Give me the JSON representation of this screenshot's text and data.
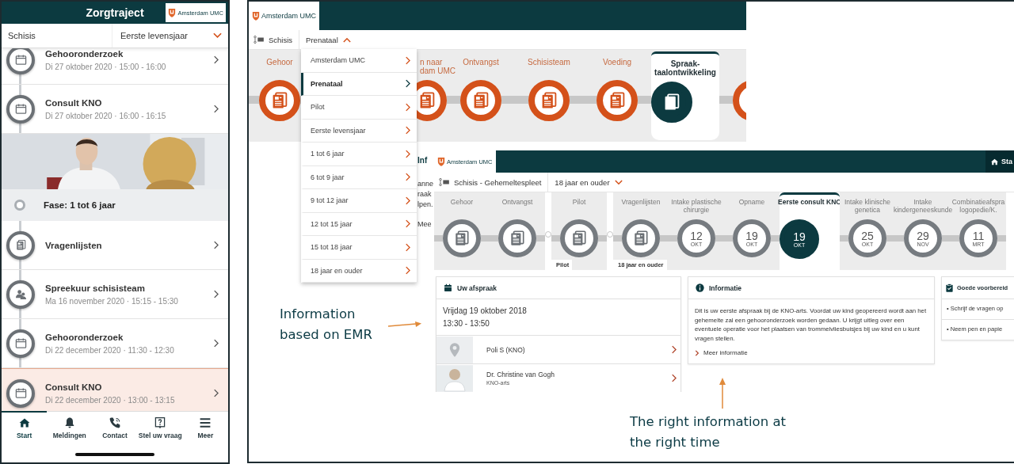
{
  "phone": {
    "title": "Zorgtraject",
    "logo": "Amsterdam UMC",
    "track": "Schisis",
    "phase": "Eerste levensjaar",
    "items": [
      {
        "kind": "appointment",
        "title": "Gehooronderzoek",
        "subtitle": "Di 27 oktober 2020 · 15:00 - 16:00",
        "selected": false
      },
      {
        "kind": "appointment",
        "title": "Consult KNO",
        "subtitle": "Di 27 oktober 2020 · 16:00 - 16:15",
        "selected": false
      },
      {
        "kind": "picture"
      },
      {
        "kind": "phase",
        "title": "Fase: 1 tot 6 jaar"
      },
      {
        "kind": "questionnaire",
        "title": "Vragenlijsten",
        "selected": false
      },
      {
        "kind": "team",
        "title": "Spreekuur schisisteam",
        "subtitle": "Ma 16 november 2020 · 15:15 - 15:30",
        "selected": false
      },
      {
        "kind": "appointment",
        "title": "Gehooronderzoek",
        "subtitle": "Di 22 december 2020 · 11:30 - 12:30",
        "selected": false
      },
      {
        "kind": "appointment",
        "title": "Consult KNO",
        "subtitle": "Di 22 december 2020 · 13:00 - 13:15",
        "selected": true
      }
    ],
    "tabs": [
      {
        "kind": "home",
        "label": "Start",
        "selected": true
      },
      {
        "kind": "bell",
        "label": "Meldingen",
        "selected": false
      },
      {
        "kind": "phone",
        "label": "Contact",
        "selected": false
      },
      {
        "kind": "question",
        "label": "Stel uw vraag",
        "selected": false
      },
      {
        "kind": "menu",
        "label": "Meer",
        "selected": false
      }
    ]
  },
  "web_top": {
    "logo": "Amsterdam UMC",
    "track": "Schisis",
    "phase": "Prenataal",
    "menu_open": true,
    "stages": [
      {
        "label": "Gehoor",
        "selected": false
      },
      {
        "label": "n naar\ndam UMC",
        "selected": false
      },
      {
        "label": "Ontvangst",
        "selected": false
      },
      {
        "label": "Schisisteam",
        "selected": false
      },
      {
        "label": "Voeding",
        "selected": false
      },
      {
        "label": "Spraak-\ntaalontwikkeling",
        "selected": true
      },
      {
        "selected": false
      }
    ],
    "menu": [
      {
        "label": "Amsterdam UMC",
        "selected": false
      },
      {
        "label": "Prenataal",
        "selected": true
      },
      {
        "label": "Pilot",
        "selected": false
      },
      {
        "label": "Eerste levensjaar",
        "selected": false
      },
      {
        "label": "1 tot 6 jaar",
        "selected": false
      },
      {
        "label": "6 tot 9 jaar",
        "selected": false
      },
      {
        "label": "9 tot 12 jaar",
        "selected": false
      },
      {
        "label": "12 tot 15 jaar",
        "selected": false
      },
      {
        "label": "15 tot 18 jaar",
        "selected": false
      },
      {
        "label": "18 jaar en ouder",
        "selected": false
      }
    ]
  },
  "web_behind": {
    "texts": [
      {
        "kind": "heading",
        "text": "Inf"
      },
      {
        "kind": "line",
        "text": "anne"
      },
      {
        "kind": "line",
        "text": "raak"
      },
      {
        "kind": "line",
        "text": "lpen."
      },
      {
        "kind": "link",
        "text": "Mee"
      }
    ]
  },
  "web_front": {
    "logo": "Amsterdam UMC",
    "home": "Sta",
    "track": "Schisis - Gehemeltespleet",
    "phase": "18 jaar en ouder",
    "groups": [
      {
        "stages": [
          {
            "label": "Gehoor",
            "kind": "document",
            "selected": false
          },
          {
            "label": "Ontvangst",
            "kind": "document",
            "selected": false
          }
        ]
      },
      {
        "label": "Pilot",
        "stages": [
          {
            "label": "Pilot",
            "kind": "document",
            "selected": false
          }
        ]
      },
      {
        "label": "18 jaar en ouder",
        "stages": [
          {
            "label": "Vragenlijsten",
            "kind": "document",
            "selected": false
          },
          {
            "label": "Intake plastische chirurgie",
            "kind": "date",
            "day": "12",
            "month": "OKT",
            "selected": false
          },
          {
            "label": "Opname",
            "kind": "date",
            "day": "19",
            "month": "OKT",
            "selected": false
          }
        ]
      },
      {
        "stages": [
          {
            "label": "Eerste consult KNO",
            "kind": "date",
            "day": "19",
            "month": "OKT",
            "selected": true
          }
        ]
      },
      {
        "stages": [
          {
            "label": "Intake klinische genetica",
            "kind": "date",
            "day": "25",
            "month": "OKT",
            "selected": false
          },
          {
            "label": "Intake kindergeneeskunde",
            "kind": "date",
            "day": "29",
            "month": "NOV",
            "selected": false
          },
          {
            "label": "Combinatieafspra\nlogopedie/K.",
            "kind": "date",
            "day": "11",
            "month": "MRT",
            "selected": false
          }
        ]
      }
    ],
    "appointment": {
      "title": "Uw afspraak",
      "date": "Vrijdag 19 oktober 2018",
      "time": "13:30 - 13:50",
      "location": "Poli S (KNO)",
      "doctor": "Dr. Christine van Gogh",
      "role": "KNO-arts"
    },
    "info": {
      "title": "Informatie",
      "text": "Dit is uw eerste afspraak bij de KNO-arts. Voordat uw kind geopereerd wordt aan het gehemelte zal een gehooronderzoek worden gedaan. U krijgt uitleg over een eventuele operatie voor het plaatsen van trommelvliesbuisjes bij uw kind en u kunt vragen stellen.",
      "link": "Meer informatie"
    },
    "prep": {
      "title": "Goede voorbereid",
      "items": [
        "• Schrijf de vragen op",
        "• Neem pen en papie"
      ]
    }
  },
  "annotations": [
    {
      "kind": "left",
      "text": "Information\nbased on EMR"
    },
    {
      "kind": "bottom",
      "text": "The right information at\nthe right time"
    }
  ]
}
